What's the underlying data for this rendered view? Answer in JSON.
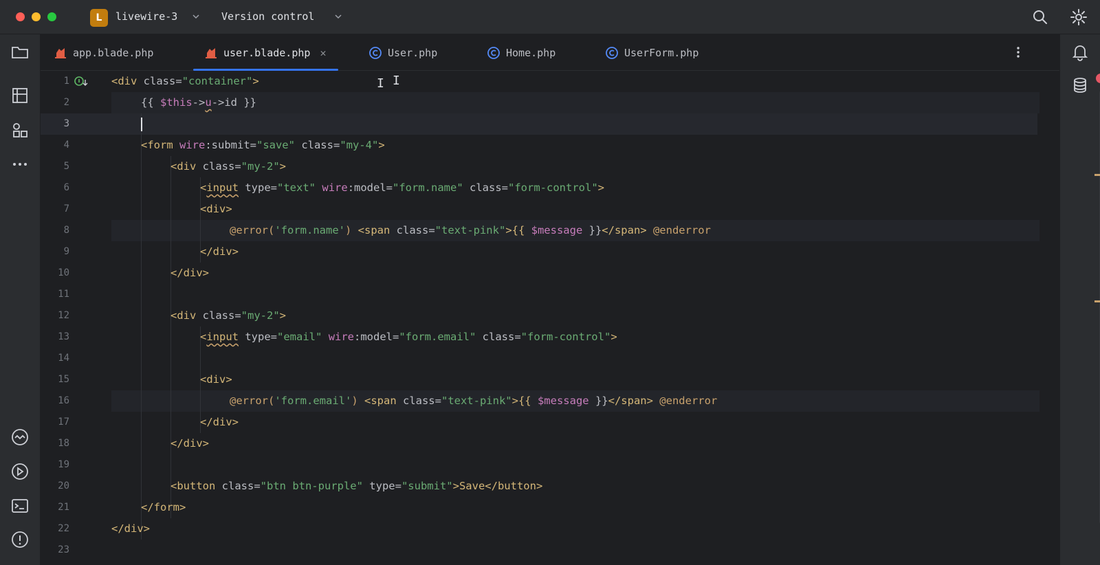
{
  "window": {
    "project_badge": "L",
    "project_name": "livewire-3",
    "vcs_label": "Version control"
  },
  "tabs": [
    {
      "label": "app.blade.php",
      "icon": "blade-file-icon",
      "active": false
    },
    {
      "label": "user.blade.php",
      "icon": "blade-file-icon",
      "active": true
    },
    {
      "label": "User.php",
      "icon": "php-class-icon",
      "active": false
    },
    {
      "label": "Home.php",
      "icon": "php-class-icon",
      "active": false
    },
    {
      "label": "UserForm.php",
      "icon": "php-class-icon",
      "active": false
    }
  ],
  "editor": {
    "current_line": 3,
    "line_numbers": [
      "1",
      "2",
      "3",
      "4",
      "5",
      "6",
      "7",
      "8",
      "9",
      "10",
      "11",
      "12",
      "13",
      "14",
      "15",
      "16",
      "17",
      "18",
      "19",
      "20",
      "21",
      "22",
      "23"
    ],
    "error_badge": "!"
  },
  "code": {
    "l1": {
      "p1": "<div ",
      "p2": "class",
      "p3": "=",
      "p4": "\"container\"",
      "p5": ">"
    },
    "l2": {
      "p1": "{{ ",
      "p2": "$this",
      "p3": "->",
      "p4": "u",
      "p5": "->id }}"
    },
    "l4": {
      "p1": "<form ",
      "p2": "wire",
      "p3": ":submit=",
      "p4": "\"save\"",
      "p5": " class=",
      "p6": "\"my-4\"",
      "p7": ">"
    },
    "l5": {
      "p1": "<div ",
      "p2": "class=",
      "p3": "\"my-2\"",
      "p4": ">"
    },
    "l6": {
      "p1": "<",
      "p2": "input",
      "p3": " type=",
      "p4": "\"text\"",
      "p5": " ",
      "p6": "wire",
      "p7": ":model=",
      "p8": "\"form.name\"",
      "p9": " class=",
      "p10": "\"form-control\"",
      "p11": ">"
    },
    "l7": {
      "p1": "<div>"
    },
    "l8": {
      "p1": "@error(",
      "p2": "'form.name'",
      "p3": ")",
      "p4": " <span ",
      "p5": "class=",
      "p6": "\"text-pink\"",
      "p7": ">{{ ",
      "p8": "$message",
      "p9": " }}",
      "p10": "</span>",
      "p11": " @enderror"
    },
    "l9": {
      "p1": "</div>"
    },
    "l10": {
      "p1": "</div>"
    },
    "l12": {
      "p1": "<div ",
      "p2": "class=",
      "p3": "\"my-2\"",
      "p4": ">"
    },
    "l13": {
      "p1": "<",
      "p2": "input",
      "p3": " type=",
      "p4": "\"email\"",
      "p5": " ",
      "p6": "wire",
      "p7": ":model=",
      "p8": "\"form.email\"",
      "p9": " class=",
      "p10": "\"form-control\"",
      "p11": ">"
    },
    "l15": {
      "p1": "<div>"
    },
    "l16": {
      "p1": "@error(",
      "p2": "'form.email'",
      "p3": ")",
      "p4": " <span ",
      "p5": "class=",
      "p6": "\"text-pink\"",
      "p7": ">{{ ",
      "p8": "$message",
      "p9": " }}",
      "p10": "</span>",
      "p11": " @enderror"
    },
    "l17": {
      "p1": "</div>"
    },
    "l18": {
      "p1": "</div>"
    },
    "l20": {
      "p1": "<button ",
      "p2": "class=",
      "p3": "\"btn btn-purple\"",
      "p4": " type=",
      "p5": "\"submit\"",
      "p6": ">Save</button>"
    },
    "l21": {
      "p1": "</form>"
    },
    "l22": {
      "p1": "</div>"
    }
  },
  "colors": {
    "accent": "#3574f0",
    "tag": "#d5b778",
    "string": "#6aab73",
    "keyword": "#c77dbb",
    "directive": "#c9a26d",
    "error": "#e55765"
  }
}
